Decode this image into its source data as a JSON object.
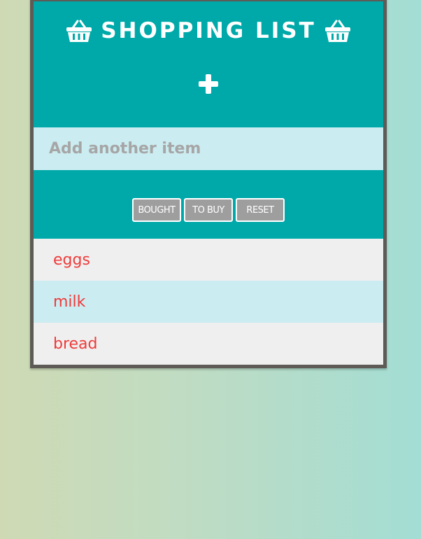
{
  "header": {
    "title": "SHOPPING LIST",
    "left_icon": "basket-icon",
    "right_icon": "basket-icon",
    "add_icon": "plus-icon"
  },
  "input": {
    "placeholder": "Add another item",
    "value": ""
  },
  "filters": {
    "bought_label": "BOUGHT",
    "tobuy_label": "TO BUY",
    "reset_label": "RESET"
  },
  "items": [
    {
      "label": "eggs"
    },
    {
      "label": "milk"
    },
    {
      "label": "bread"
    }
  ],
  "colors": {
    "teal": "#00a9a9",
    "light_blue": "#cbecf1",
    "light_gray": "#efefef",
    "item_text": "#ef3b3b",
    "border": "#5e5a55"
  }
}
